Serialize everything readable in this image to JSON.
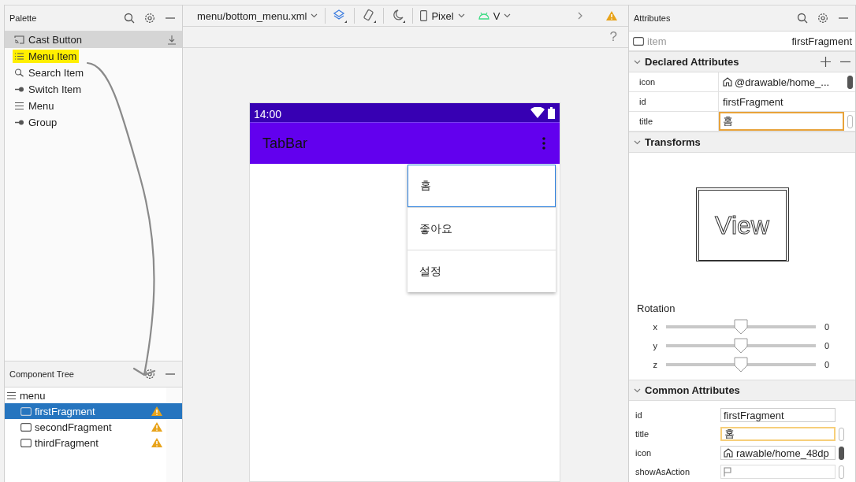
{
  "palette": {
    "title": "Palette",
    "items": [
      {
        "label": "Cast Button",
        "kind": "cast",
        "selected": true,
        "highlighted": false,
        "download": true
      },
      {
        "label": "Menu Item",
        "kind": "list",
        "selected": false,
        "highlighted": true,
        "download": false
      },
      {
        "label": "Search Item",
        "kind": "search",
        "selected": false,
        "highlighted": false,
        "download": false
      },
      {
        "label": "Switch Item",
        "kind": "switch",
        "selected": false,
        "highlighted": false,
        "download": false
      },
      {
        "label": "Menu",
        "kind": "menu",
        "selected": false,
        "highlighted": false,
        "download": false
      },
      {
        "label": "Group",
        "kind": "switch",
        "selected": false,
        "highlighted": false,
        "download": false
      }
    ]
  },
  "component_tree": {
    "title": "Component Tree",
    "root": {
      "label": "menu",
      "children": [
        {
          "label": "firstFragment",
          "selected": true,
          "warning": true
        },
        {
          "label": "secondFragment",
          "selected": false,
          "warning": true
        },
        {
          "label": "thirdFragment",
          "selected": false,
          "warning": true
        }
      ]
    }
  },
  "toolbar": {
    "file": "menu/bottom_menu.xml",
    "device": "Pixel",
    "api": "V",
    "help": "?"
  },
  "phone": {
    "time": "14:00",
    "app_title": "TabBar",
    "menu_items": [
      {
        "label": "홈",
        "selected": true
      },
      {
        "label": "좋아요",
        "selected": false
      },
      {
        "label": "설정",
        "selected": false
      }
    ]
  },
  "attributes": {
    "title": "Attributes",
    "component_type": "item",
    "component_id": "firstFragment",
    "declared": {
      "title": "Declared Attributes",
      "rows": [
        {
          "name": "icon",
          "value": "@drawable/home_...",
          "kind": "resource",
          "focused": false
        },
        {
          "name": "id",
          "value": "firstFragment",
          "kind": "text",
          "focused": false
        },
        {
          "name": "title",
          "value": "홈",
          "kind": "text",
          "focused": true
        }
      ]
    },
    "transforms": {
      "title": "Transforms",
      "preview": "View",
      "rotation_label": "Rotation",
      "axes": [
        {
          "axis": "x",
          "level": 0.5,
          "reading": "0"
        },
        {
          "axis": "y",
          "level": 0.5,
          "reading": "0"
        },
        {
          "axis": "z",
          "level": 0.5,
          "reading": "0"
        }
      ]
    },
    "common": {
      "title": "Common Attributes",
      "rows": [
        {
          "name": "id",
          "value": "firstFragment",
          "kind": "text",
          "focused": false
        },
        {
          "name": "title",
          "value": "홈",
          "kind": "text",
          "focused": true
        },
        {
          "name": "icon",
          "value": "rawable/home_48dp",
          "kind": "resource",
          "focused": false
        },
        {
          "name": "showAsAction",
          "value": "",
          "kind": "flag",
          "focused": false
        }
      ]
    }
  }
}
